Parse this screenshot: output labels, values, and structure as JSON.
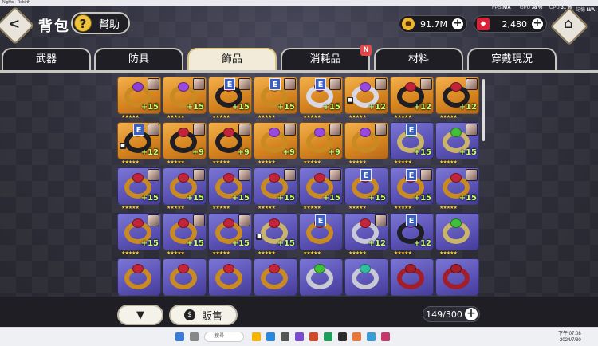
{
  "window": {
    "title": "Nights - Rebirth"
  },
  "header": {
    "title": "背包",
    "help_icon": "?",
    "help_label": "幫助",
    "perf": {
      "fps_label": "FPS",
      "fps_value": "N/A",
      "gpu_label": "GPU",
      "gpu_value": "38 %",
      "cpu_label": "CPU",
      "cpu_value": "31 %",
      "mem_label": "記憶",
      "mem_value": "N/A"
    },
    "gold_icon": "gold-coin-icon",
    "gold_value": "91.7M",
    "gem_icon": "red-gem-icon",
    "gem_value": "2,480",
    "plus": "+"
  },
  "tabs": [
    {
      "label": "武器"
    },
    {
      "label": "防具"
    },
    {
      "label": "飾品",
      "active": true
    },
    {
      "label": "消耗品",
      "badge": "N"
    },
    {
      "label": "材料"
    },
    {
      "label": "穿戴現況"
    }
  ],
  "items": [
    {
      "bg": "gold",
      "gem": "#8d3fd6",
      "ring": "#c98a22",
      "portrait": true,
      "equipped": false,
      "lock": false,
      "plus": "+15"
    },
    {
      "bg": "gold",
      "gem": "#9a48e0",
      "ring": "#c98a22",
      "portrait": true,
      "equipped": false,
      "lock": false,
      "plus": "+15"
    },
    {
      "bg": "gold",
      "gem": "#c2253a",
      "ring": "#1e1e24",
      "portrait": true,
      "equipped": true,
      "lock": false,
      "plus": "+15"
    },
    {
      "bg": "gold",
      "gem": "#e6a33a",
      "ring": "#c98a22",
      "portrait": true,
      "equipped": true,
      "lock": false,
      "plus": "+15"
    },
    {
      "bg": "gold",
      "gem": "#8d3fd6",
      "ring": "#d9d9e6",
      "portrait": true,
      "equipped": true,
      "lock": false,
      "plus": "+15"
    },
    {
      "bg": "gold",
      "gem": "#9a48e0",
      "ring": "#d9d9e6",
      "portrait": true,
      "equipped": false,
      "lock": true,
      "plus": "+12"
    },
    {
      "bg": "gold",
      "gem": "#c2253a",
      "ring": "#1e1e24",
      "portrait": true,
      "equipped": false,
      "lock": false,
      "plus": "+12"
    },
    {
      "bg": "gold",
      "gem": "#c2253a",
      "ring": "#1e1e24",
      "portrait": true,
      "equipped": false,
      "lock": false,
      "plus": "+12"
    },
    {
      "bg": "gold",
      "gem": "#e6a33a",
      "ring": "#1e1e24",
      "portrait": true,
      "equipped": true,
      "lock": true,
      "plus": "+12"
    },
    {
      "bg": "gold",
      "gem": "#c2253a",
      "ring": "#1e1e24",
      "portrait": true,
      "equipped": false,
      "lock": false,
      "plus": "+9"
    },
    {
      "bg": "gold",
      "gem": "#c2253a",
      "ring": "#1e1e24",
      "portrait": true,
      "equipped": false,
      "lock": false,
      "plus": "+9"
    },
    {
      "bg": "gold",
      "gem": "#9a48e0",
      "ring": "#c98a22",
      "portrait": true,
      "equipped": false,
      "lock": false,
      "plus": "+9"
    },
    {
      "bg": "gold",
      "gem": "#9a48e0",
      "ring": "#c98a22",
      "portrait": true,
      "equipped": false,
      "lock": false,
      "plus": "+9"
    },
    {
      "bg": "gold",
      "gem": "#9a48e0",
      "ring": "#c98a22",
      "portrait": true,
      "equipped": false,
      "lock": false,
      "plus": ""
    },
    {
      "bg": "purple",
      "gem": "#3fbf3a",
      "ring": "#c9b46a",
      "portrait": false,
      "equipped": true,
      "lock": false,
      "plus": "+15"
    },
    {
      "bg": "purple",
      "gem": "#3fbf3a",
      "ring": "#c9b46a",
      "portrait": true,
      "equipped": false,
      "lock": false,
      "plus": "+15"
    },
    {
      "bg": "purple",
      "gem": "#c2253a",
      "ring": "#c98a22",
      "portrait": true,
      "equipped": false,
      "lock": false,
      "plus": "+15"
    },
    {
      "bg": "purple",
      "gem": "#c2253a",
      "ring": "#c98a22",
      "portrait": true,
      "equipped": false,
      "lock": false,
      "plus": "+15"
    },
    {
      "bg": "purple",
      "gem": "#c2253a",
      "ring": "#c98a22",
      "portrait": true,
      "equipped": false,
      "lock": false,
      "plus": "+15"
    },
    {
      "bg": "purple",
      "gem": "#c2253a",
      "ring": "#c98a22",
      "portrait": true,
      "equipped": false,
      "lock": false,
      "plus": "+15"
    },
    {
      "bg": "purple",
      "gem": "#c2253a",
      "ring": "#c98a22",
      "portrait": true,
      "equipped": false,
      "lock": false,
      "plus": "+15"
    },
    {
      "bg": "purple",
      "gem": "#c2253a",
      "ring": "#c98a22",
      "portrait": false,
      "equipped": true,
      "lock": false,
      "plus": "+15"
    },
    {
      "bg": "purple",
      "gem": "#c2253a",
      "ring": "#c98a22",
      "portrait": true,
      "equipped": true,
      "lock": false,
      "plus": "+15"
    },
    {
      "bg": "purple",
      "gem": "#c2253a",
      "ring": "#c98a22",
      "portrait": true,
      "equipped": false,
      "lock": false,
      "plus": "+15"
    },
    {
      "bg": "purple",
      "gem": "#c2253a",
      "ring": "#c98a22",
      "portrait": true,
      "equipped": false,
      "lock": false,
      "plus": "+15"
    },
    {
      "bg": "purple",
      "gem": "#c2253a",
      "ring": "#c98a22",
      "portrait": true,
      "equipped": false,
      "lock": false,
      "plus": "+15"
    },
    {
      "bg": "purple",
      "gem": "#c2253a",
      "ring": "#c98a22",
      "portrait": true,
      "equipped": false,
      "lock": false,
      "plus": "+15"
    },
    {
      "bg": "purple",
      "gem": "#c2253a",
      "ring": "#c9b46a",
      "portrait": false,
      "equipped": false,
      "lock": true,
      "plus": "+15"
    },
    {
      "bg": "purple",
      "gem": "#c2253a",
      "ring": "#c98a22",
      "portrait": false,
      "equipped": true,
      "lock": false,
      "plus": ""
    },
    {
      "bg": "purple",
      "gem": "#c2253a",
      "ring": "#c9c9d6",
      "portrait": true,
      "equipped": false,
      "lock": false,
      "plus": "+12"
    },
    {
      "bg": "purple",
      "gem": "#8d3fd6",
      "ring": "#1e1e24",
      "portrait": false,
      "equipped": true,
      "lock": false,
      "plus": "+12"
    },
    {
      "bg": "purple",
      "gem": "#3fbf3a",
      "ring": "#c9b46a",
      "portrait": false,
      "equipped": false,
      "lock": false,
      "plus": ""
    },
    {
      "bg": "purple",
      "gem": "#c2253a",
      "ring": "#c98a22",
      "portrait": false,
      "equipped": false,
      "lock": false,
      "plus": ""
    },
    {
      "bg": "purple",
      "gem": "#c2253a",
      "ring": "#c98a22",
      "portrait": false,
      "equipped": false,
      "lock": false,
      "plus": ""
    },
    {
      "bg": "purple",
      "gem": "#c2253a",
      "ring": "#c98a22",
      "portrait": false,
      "equipped": false,
      "lock": false,
      "plus": ""
    },
    {
      "bg": "purple",
      "gem": "#c2253a",
      "ring": "#c98a22",
      "portrait": false,
      "equipped": false,
      "lock": false,
      "plus": ""
    },
    {
      "bg": "purple",
      "gem": "#3fbf3a",
      "ring": "#c9c9d6",
      "portrait": false,
      "equipped": false,
      "lock": false,
      "plus": ""
    },
    {
      "bg": "purple",
      "gem": "#2fbfa0",
      "ring": "#c9c9d6",
      "portrait": false,
      "equipped": false,
      "lock": false,
      "plus": ""
    },
    {
      "bg": "purple",
      "gem": "#a11e2a",
      "ring": "#a11e2a",
      "portrait": false,
      "equipped": false,
      "lock": false,
      "plus": ""
    },
    {
      "bg": "purple",
      "gem": "#a11e2a",
      "ring": "#a11e2a",
      "portrait": false,
      "equipped": false,
      "lock": false,
      "plus": ""
    }
  ],
  "footer": {
    "filter_icon": "filter-icon",
    "filter_glyph": "▼",
    "sell_icon": "money-bag-icon",
    "sell_glyph": "$",
    "sell_label": "販售",
    "capacity": "149/300",
    "plus": "+"
  },
  "taskbar": {
    "search_placeholder": "搜尋",
    "time": "下午 07:08",
    "date": "2024/7/30"
  }
}
